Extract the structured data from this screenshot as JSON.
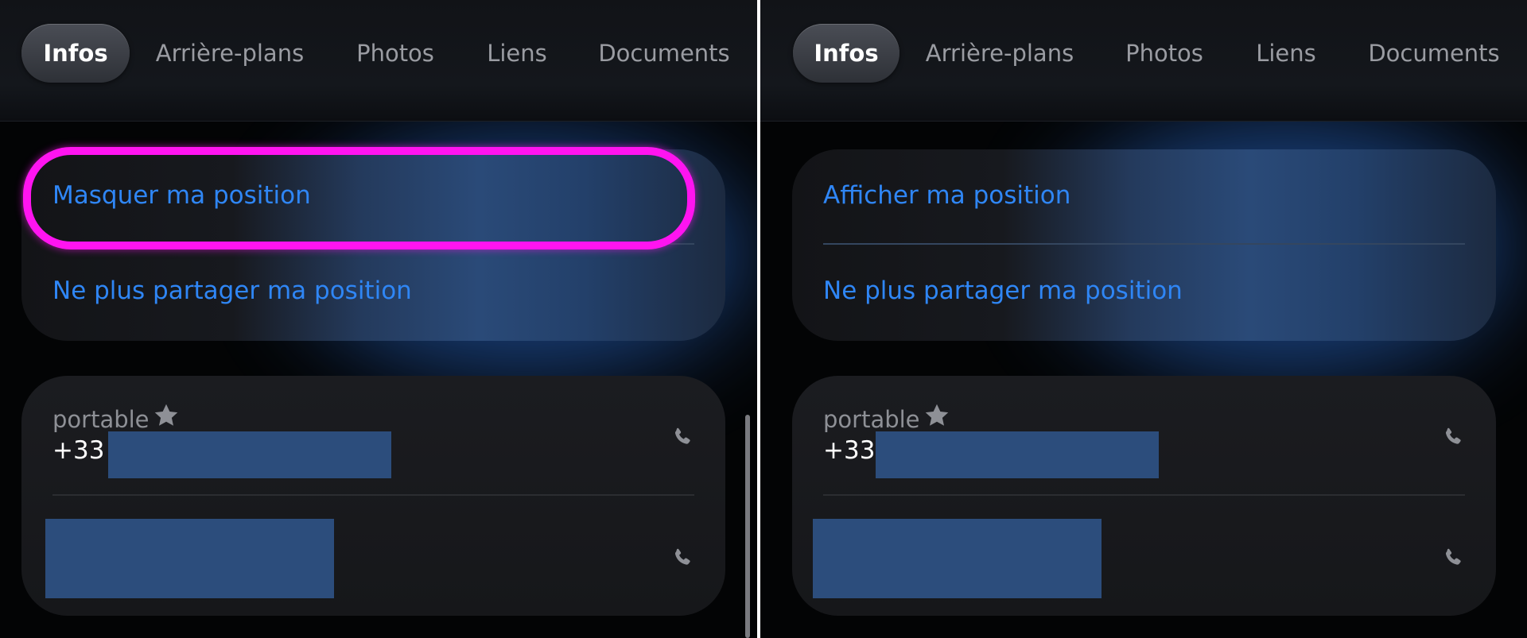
{
  "colors": {
    "accent_blue": "#2f86f5",
    "highlight_magenta": "#ff14f0",
    "redaction_blue": "#2c4d7c",
    "background": "#030405"
  },
  "panels": [
    {
      "tabs": [
        "Infos",
        "Arrière-plans",
        "Photos",
        "Liens",
        "Documents"
      ],
      "active_tab": "Infos",
      "location_actions": [
        "Masquer ma position",
        "Ne plus partager ma position"
      ],
      "highlighted_action": "Masquer ma position",
      "phone": {
        "label": "portable",
        "favorite_icon": "star-icon",
        "number_prefix": "+33",
        "call_icon": "phone-icon"
      }
    },
    {
      "tabs": [
        "Infos",
        "Arrière-plans",
        "Photos",
        "Liens",
        "Documents"
      ],
      "active_tab": "Infos",
      "location_actions": [
        "Afficher ma position",
        "Ne plus partager ma position"
      ],
      "phone": {
        "label": "portable",
        "favorite_icon": "star-icon",
        "number_prefix": "+33",
        "call_icon": "phone-icon"
      }
    }
  ]
}
